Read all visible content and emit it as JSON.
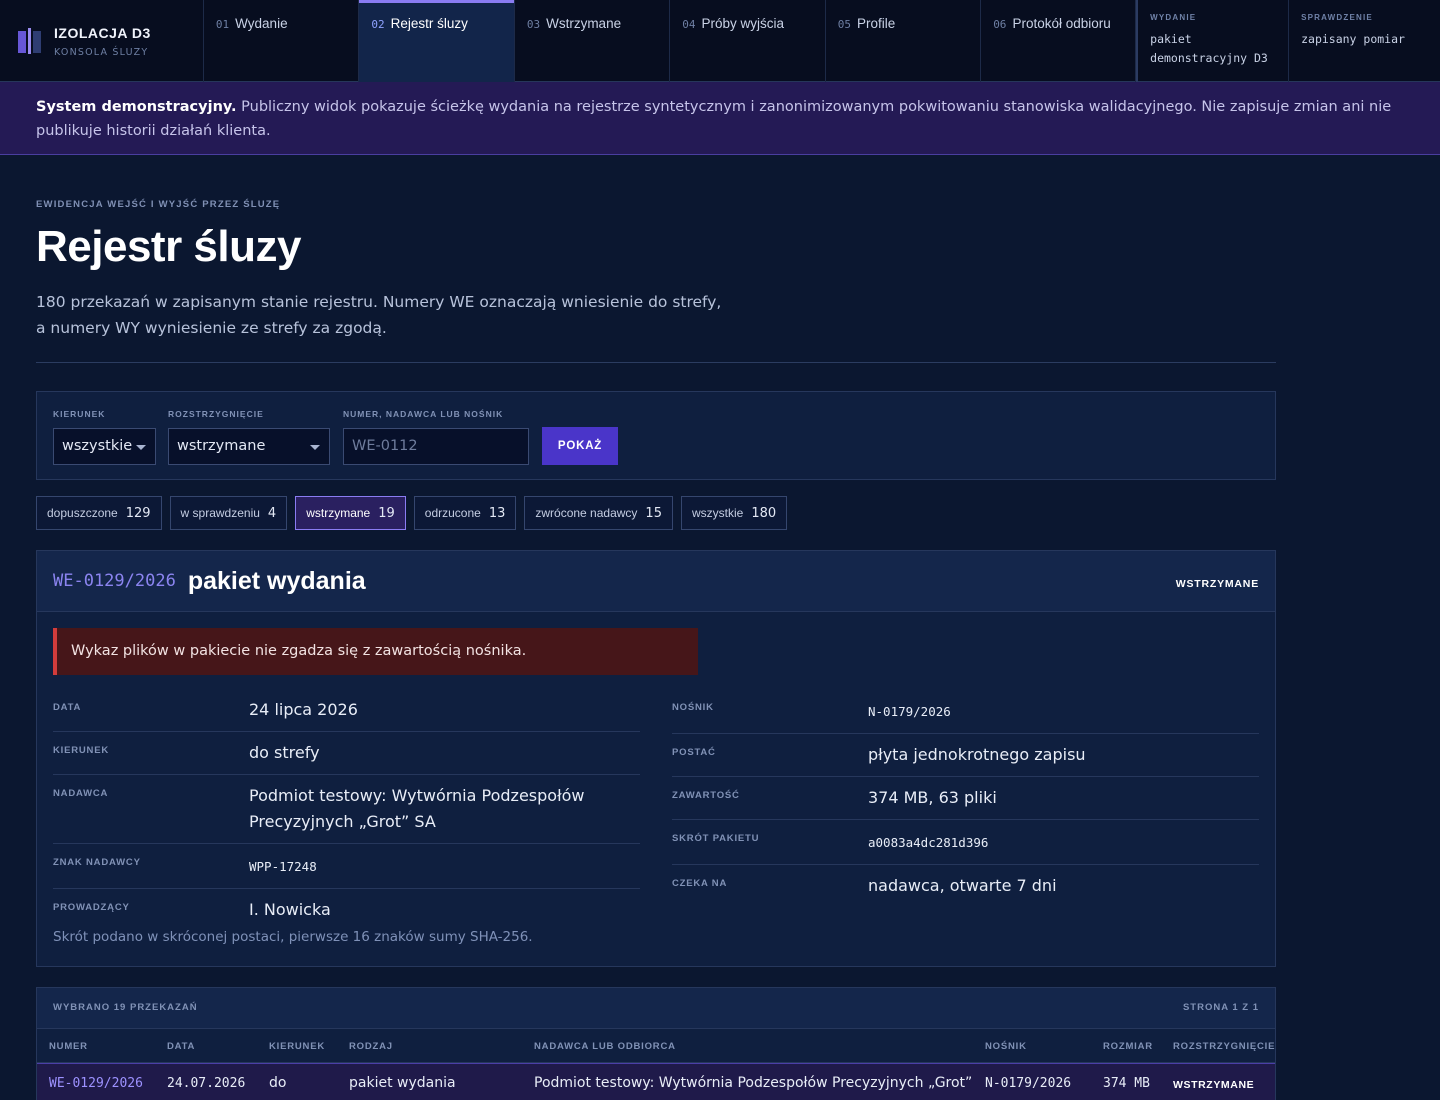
{
  "brand": {
    "title": "IZOLACJA D3",
    "subtitle": "KONSOLA ŚLUZY"
  },
  "tabs": [
    {
      "num": "01",
      "label": "Wydanie"
    },
    {
      "num": "02",
      "label": "Rejestr śluzy"
    },
    {
      "num": "03",
      "label": "Wstrzymane"
    },
    {
      "num": "04",
      "label": "Próby wyjścia"
    },
    {
      "num": "05",
      "label": "Profile"
    },
    {
      "num": "06",
      "label": "Protokół odbioru"
    }
  ],
  "meta": [
    {
      "label": "WYDANIE",
      "value": "pakiet demonstracyjny D3"
    },
    {
      "label": "SPRAWDZENIE",
      "value": "zapisany pomiar"
    }
  ],
  "banner": {
    "strong": "System demonstracyjny.",
    "text": "Publiczny widok pokazuje ścieżkę wydania na rejestrze syntetycznym i zanonimizowanym pokwitowaniu stanowiska walidacyjnego. Nie zapisuje zmian ani nie publikuje historii działań klienta."
  },
  "header": {
    "eyebrow": "EWIDENCJA WEJŚĆ I WYJŚĆ PRZEZ ŚLUZĘ",
    "title": "Rejestr śluzy",
    "description": "180 przekazań w zapisanym stanie rejestru. Numery WE oznaczają wniesienie do strefy, a numery WY wyniesienie ze strefy za zgodą."
  },
  "filters": {
    "direction_label": "KIERUNEK",
    "direction_value": "wszystkie",
    "resolution_label": "ROZSTRZYGNIĘCIE",
    "resolution_value": "wstrzymane",
    "search_label": "NUMER, NADAWCA LUB NOŚNIK",
    "search_placeholder": "WE-0112",
    "submit_label": "POKAŻ"
  },
  "chips": [
    {
      "label": "dopuszczone",
      "count": "129"
    },
    {
      "label": "w sprawdzeniu",
      "count": "4"
    },
    {
      "label": "wstrzymane",
      "count": "19"
    },
    {
      "label": "odrzucone",
      "count": "13"
    },
    {
      "label": "zwrócone nadawcy",
      "count": "15"
    },
    {
      "label": "wszystkie",
      "count": "180"
    }
  ],
  "active_chip": "wstrzymane",
  "detail": {
    "number": "WE-0129/2026",
    "title": "pakiet wydania",
    "status": "WSTRZYMANE",
    "alert": "Wykaz plików w pakiecie nie zgadza się z zawartością nośnika.",
    "left": [
      {
        "key": "DATA",
        "value": "24 lipca 2026"
      },
      {
        "key": "KIERUNEK",
        "value": "do strefy"
      },
      {
        "key": "NADAWCA",
        "value": "Podmiot testowy: Wytwórnia Podzespołów Precyzyjnych „Grot” SA"
      },
      {
        "key": "ZNAK NADAWCY",
        "value": "WPP-17248"
      },
      {
        "key": "PROWADZĄCY",
        "value": "I. Nowicka"
      }
    ],
    "right": [
      {
        "key": "NOŚNIK",
        "value": "N-0179/2026"
      },
      {
        "key": "POSTAĆ",
        "value": "płyta jednokrotnego zapisu"
      },
      {
        "key": "ZAWARTOŚĆ",
        "value": "374 MB, 63 pliki"
      },
      {
        "key": "SKRÓT PAKIETU",
        "value": "a0083a4dc281d396"
      },
      {
        "key": "CZEKA NA",
        "value": "nadawca, otwarte 7 dni"
      }
    ],
    "note": "Skrót podano w skróconej postaci, pierwsze 16 znaków sumy SHA-256."
  },
  "table": {
    "selected_label": "WYBRANO 19 PRZEKAZAŃ",
    "page_label": "STRONA 1 Z 1",
    "columns": [
      "NUMER",
      "DATA",
      "KIERUNEK",
      "RODZAJ",
      "NADAWCA LUB ODBIORCA",
      "NOŚNIK",
      "ROZMIAR",
      "ROZSTRZYGNIĘCIE"
    ],
    "rows": [
      {
        "number": "WE-0129/2026",
        "date": "24.07.2026",
        "direction": "do",
        "kind": "pakiet wydania",
        "party": "Podmiot testowy: Wytwórnia Podzespołów Precyzyjnych „Grot”",
        "medium": "N-0179/2026",
        "size": "374 MB",
        "resolution": "WSTRZYMANE"
      }
    ]
  },
  "colors": {
    "accent": "#8a7cf2",
    "button": "#4a35c9",
    "alert_border": "#d23c3c",
    "background": "#0b1730"
  }
}
